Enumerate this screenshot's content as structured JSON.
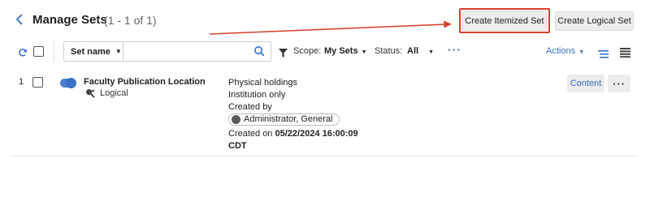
{
  "header": {
    "title": "Manage Sets",
    "count": "(1 - 1 of 1)",
    "create_itemized_label": "Create Itemized Set",
    "create_logical_label": "Create Logical Set"
  },
  "toolbar": {
    "search_field_label": "Set name",
    "search_value": "",
    "scope_label": "Scope:",
    "scope_value": "My Sets",
    "status_label": "Status:",
    "status_value": "All",
    "more_label": "···",
    "actions_label": "Actions"
  },
  "rows": [
    {
      "number": "1",
      "name": "Faculty Publication Location",
      "type": "Logical",
      "content_type": "Physical holdings",
      "scope": "Institution only",
      "created_by_label": "Created by",
      "created_by": "Administrator, General",
      "created_on_label": "Created on",
      "created_on": "05/22/2024 16:00:09",
      "timezone": "CDT",
      "content_button": "Content",
      "more_button": "···"
    }
  ],
  "colors": {
    "accent": "#3a6fc4",
    "highlight": "#d7402b"
  },
  "icons": [
    "back-icon",
    "refresh-icon",
    "search-icon",
    "filter-icon",
    "chevron-down-icon",
    "magnify-gear-icon",
    "list-compact-icon",
    "list-view-icon",
    "person-icon"
  ]
}
